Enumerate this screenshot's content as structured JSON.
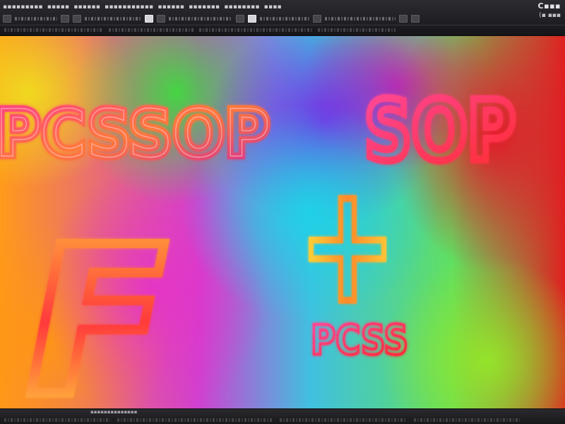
{
  "top": {
    "menu": [
      "▪▪▪▪▪▪▪▪▪",
      "▪▪▪▪▪",
      "▪▪▪▪▪▪",
      "▪▪▪▪▪▪▪▪▪▪▪",
      "▪▪▪▪▪▪",
      "▪▪▪▪▪▪▪",
      "▪▪▪▪▪▪▪▪",
      "▪▪▪▪"
    ],
    "brand": "C▪▪▪",
    "brand_sub": "(▪ ▪▪▪"
  },
  "canvas": {
    "words": {
      "top_left": "PCSSOP",
      "top_right": "SOP",
      "big_letter": "F",
      "cross": "+",
      "bottom": "PCSS"
    }
  },
  "status": {
    "label": "▪▪▪▪▪▪▪▪▪▪▪▪▪▪"
  },
  "colors": {
    "chrome_dark": "#1b1b1e",
    "chrome_mid": "#2c2c30",
    "text_light": "#c9c9cf"
  }
}
